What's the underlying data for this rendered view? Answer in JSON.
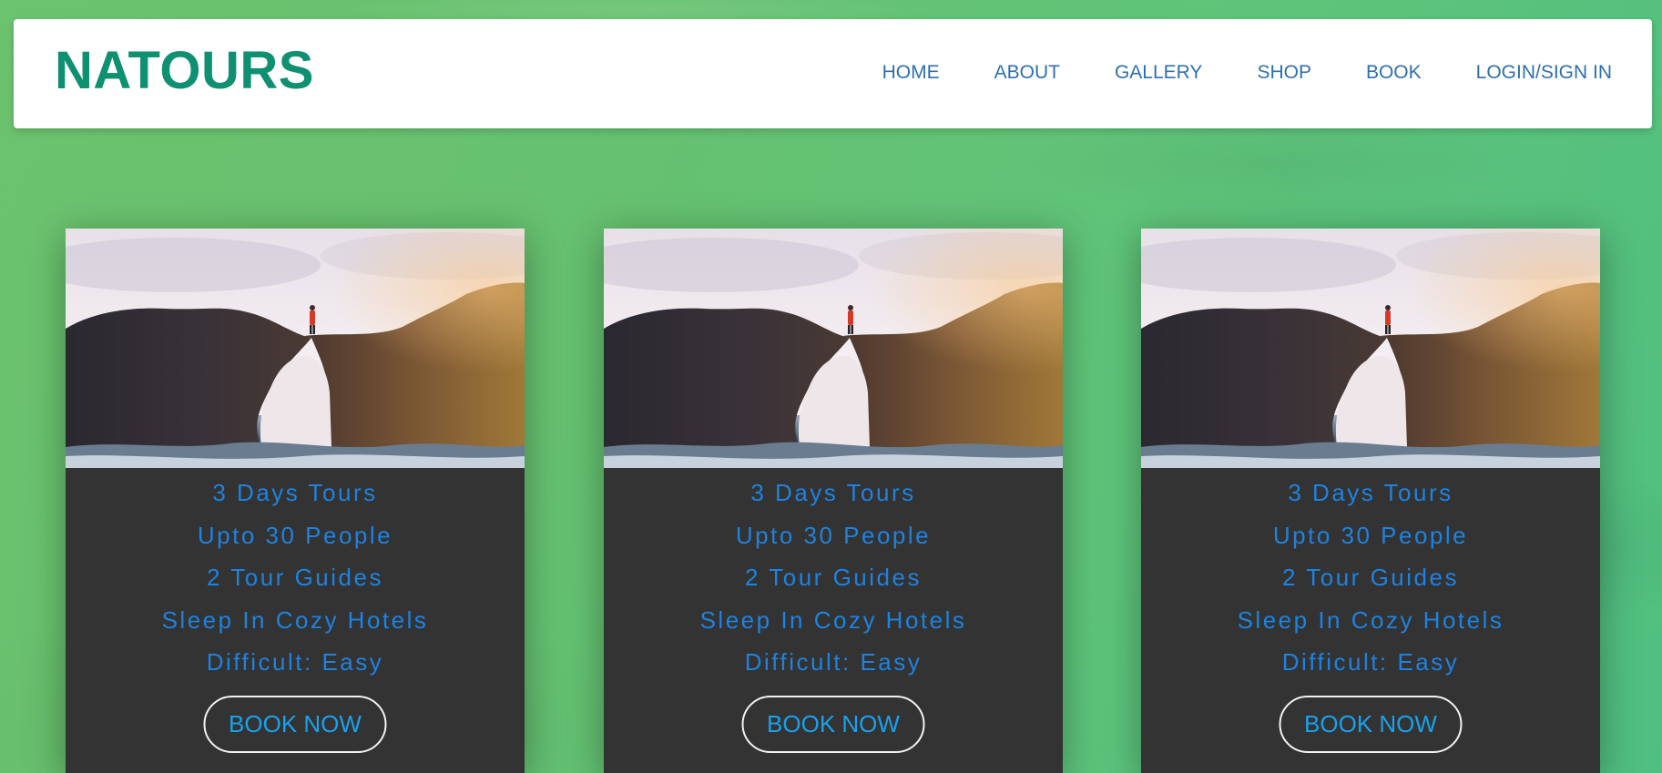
{
  "header": {
    "logo": "NATOURS",
    "nav": [
      "HOME",
      "ABOUT",
      "GALLERY",
      "SHOP",
      "BOOK",
      "LOGIN/SIGN IN"
    ]
  },
  "cards": [
    {
      "image": "sea-arch-photo",
      "details": [
        "3 Days Tours",
        "Upto 30 People",
        "2 Tour Guides",
        "Sleep In Cozy Hotels",
        "Difficult: Easy"
      ],
      "button": "BOOK NOW"
    },
    {
      "image": "sea-arch-photo",
      "details": [
        "3 Days Tours",
        "Upto 30 People",
        "2 Tour Guides",
        "Sleep In Cozy Hotels",
        "Difficult: Easy"
      ],
      "button": "BOOK NOW"
    },
    {
      "image": "sea-arch-photo",
      "details": [
        "3 Days Tours",
        "Upto 30 People",
        "2 Tour Guides",
        "Sleep In Cozy Hotels",
        "Difficult: Easy"
      ],
      "button": "BOOK NOW"
    }
  ],
  "colors": {
    "brand": "#0f9070",
    "nav_link": "#2f6fae",
    "card_bg": "#333333",
    "card_text": "#1e82e0",
    "button_text": "#19a1ec"
  }
}
